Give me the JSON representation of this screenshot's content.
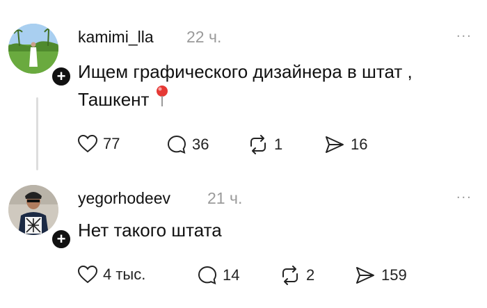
{
  "posts": [
    {
      "username": "kamimi_lla",
      "time": "22 ч.",
      "more": "...",
      "text_line1": "Ищем графического дизайнера в штат ,",
      "text_line2": "Ташкент",
      "pin_icon": "round-pushpin-icon",
      "actions": {
        "likes": "77",
        "replies": "36",
        "reposts": "1",
        "shares": "16"
      }
    },
    {
      "username": "yegorhodeev",
      "time": "21 ч.",
      "more": "...",
      "text_line1": "Нет такого штата",
      "actions": {
        "likes": "4 тыс.",
        "replies": "14",
        "reposts": "2",
        "shares": "159"
      }
    }
  ],
  "follow_symbol": "+"
}
